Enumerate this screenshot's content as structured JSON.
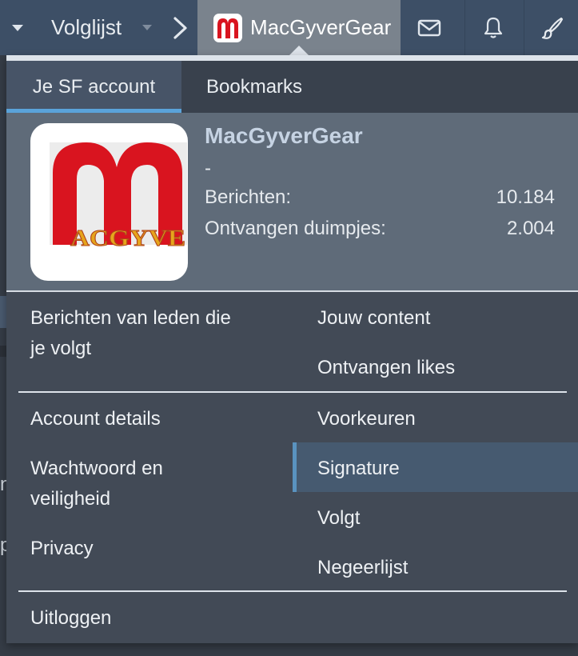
{
  "nav": {
    "volglijst": "Volglijst",
    "account_name": "MacGyverGear",
    "icons": [
      "caret-down-icon",
      "chevron-right-icon",
      "mail-icon",
      "bell-icon",
      "brush-icon"
    ]
  },
  "menu": {
    "tabs": [
      {
        "label": "Je SF account",
        "active": true
      },
      {
        "label": "Bookmarks",
        "active": false
      }
    ],
    "profile": {
      "name": "MacGyverGear",
      "title": "-",
      "posts_label": "Berichten:",
      "posts_value": "10.184",
      "likes_label": "Ontvangen duimpjes:",
      "likes_value": "2.004",
      "avatar_text": "ACGYVE"
    },
    "left_links": {
      "berichten_line1": "Berichten van leden die",
      "berichten_line2": "je volgt",
      "account_details": "Account details",
      "wachtwoord_line1": "Wachtwoord en",
      "wachtwoord_line2": "veiligheid",
      "privacy": "Privacy",
      "uitloggen": "Uitloggen"
    },
    "right_links": {
      "jouw_content": "Jouw content",
      "ontvangen_likes": "Ontvangen likes",
      "voorkeuren": "Voorkeuren",
      "signature": "Signature",
      "volgt": "Volgt",
      "negeerlijst": "Negeerlijst"
    }
  },
  "colors": {
    "navbar": "#3d4f66",
    "menu_bg": "#424a56",
    "profile_bg": "#5f6b79",
    "accent": "#5aa3da",
    "logo_red": "#d9141f"
  },
  "background": {
    "letter_m": "n",
    "letter_p": "p"
  }
}
